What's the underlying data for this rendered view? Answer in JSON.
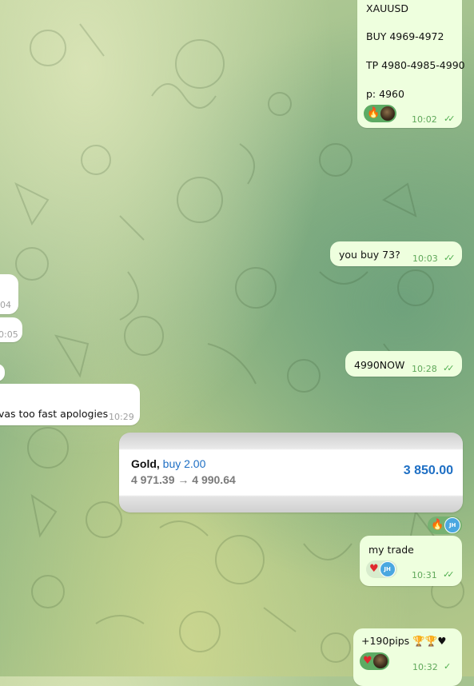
{
  "messages": {
    "signal": {
      "lines": [
        "XAUUSD",
        "BUY 4969-4972",
        "TP 4980-4985-4990",
        "p: 4960"
      ],
      "time": "10:02",
      "reactions": [
        "🔥"
      ]
    },
    "you_buy": {
      "text": "you buy 73?",
      "time": "10:03"
    },
    "inc_partial_1": {
      "time": "04"
    },
    "inc_partial_2": {
      "time": "0:05"
    },
    "now": {
      "text": "4990NOW",
      "time": "10:28"
    },
    "apology": {
      "text": "vas too fast apologies",
      "time": "10:29"
    },
    "trade_card": {
      "symbol": "Gold,",
      "direction": "buy 2.00",
      "prices": "4 971.39 → 4 990.64",
      "profit": "3 850.00"
    },
    "card_reactions": {
      "emoji": "🔥",
      "avatar_initials": "JH"
    },
    "my_trade": {
      "text": "my trade",
      "time": "10:31",
      "reaction_emoji": "♥",
      "avatar_initials": "JH"
    },
    "pips": {
      "text": "+190pips 🏆🏆♥",
      "time": "10:32",
      "reaction_emoji": "♥"
    }
  },
  "colors": {
    "outgoing_bubble": "#eeffde",
    "incoming_bubble": "#ffffff",
    "time_green": "#5fa85a",
    "profit_blue": "#1e6fc4",
    "reaction_green": "#5dab63"
  }
}
